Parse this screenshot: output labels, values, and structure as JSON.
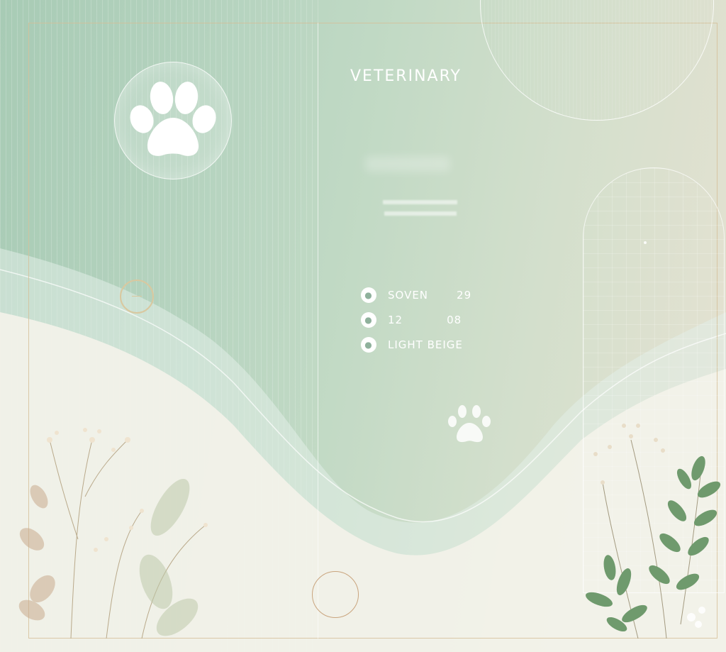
{
  "title": "VETERINARY",
  "details": [
    {
      "label": "SOVEN",
      "value": "29"
    },
    {
      "label": "12",
      "value": "08"
    },
    {
      "label": "LIGHT BEIGE",
      "value": ""
    }
  ],
  "colors": {
    "sage": "#a8cbb5",
    "beige": "#e7e2d2",
    "gold_line": "#d4be96",
    "leaf_green": "#6f9a6d"
  },
  "icons": [
    "paw-icon",
    "paw-icon-small"
  ]
}
